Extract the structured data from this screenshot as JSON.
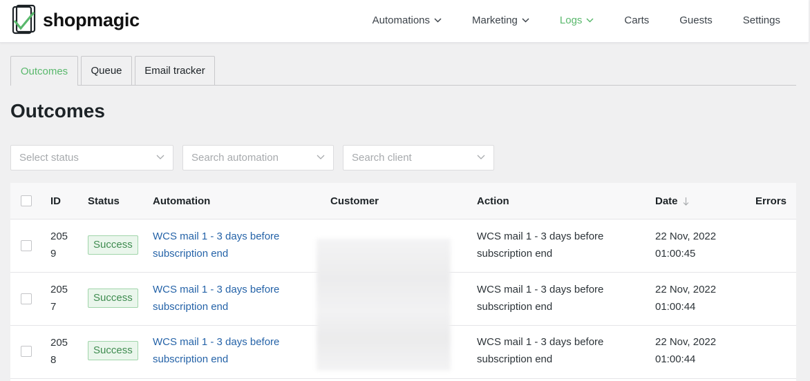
{
  "brand": {
    "name": "shopmagic",
    "accent": "#59b86c",
    "link": "#2563a8"
  },
  "nav": {
    "automations": "Automations",
    "marketing": "Marketing",
    "logs": "Logs",
    "carts": "Carts",
    "guests": "Guests",
    "settings": "Settings"
  },
  "tabs": {
    "outcomes": "Outcomes",
    "queue": "Queue",
    "email_tracker": "Email tracker"
  },
  "page_title": "Outcomes",
  "filters": {
    "status_placeholder": "Select status",
    "automation_placeholder": "Search automation",
    "client_placeholder": "Search client"
  },
  "table": {
    "headers": {
      "id": "ID",
      "status": "Status",
      "automation": "Automation",
      "customer": "Customer",
      "action": "Action",
      "date": "Date",
      "errors": "Errors"
    },
    "rows": [
      {
        "id": "2059",
        "status": "Success",
        "automation_l1": "WCS mail 1 - 3 days before",
        "automation_l2": "subscription end",
        "action_l1": "WCS mail 1 - 3 days before",
        "action_l2": "subscription end",
        "date_l1": "22 Nov, 2022",
        "date_l2": "01:00:45"
      },
      {
        "id": "2057",
        "status": "Success",
        "automation_l1": "WCS mail 1 - 3 days before",
        "automation_l2": "subscription end",
        "action_l1": "WCS mail 1 - 3 days before",
        "action_l2": "subscription end",
        "date_l1": "22 Nov, 2022",
        "date_l2": "01:00:44"
      },
      {
        "id": "2058",
        "status": "Success",
        "automation_l1": "WCS mail 1 - 3 days before",
        "automation_l2": "subscription end",
        "action_l1": "WCS mail 1 - 3 days before",
        "action_l2": "subscription end",
        "date_l1": "22 Nov, 2022",
        "date_l2": "01:00:44"
      }
    ]
  }
}
